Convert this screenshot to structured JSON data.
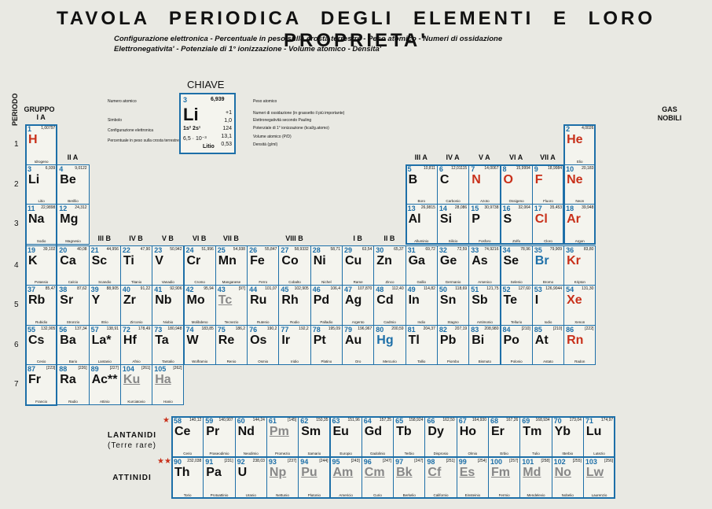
{
  "title": "TAVOLA PERIODICA DEGLI ELEMENTI E LORO PROPRIETA'",
  "subtitle_line1": "Configurazione elettronica - Percentuale in peso sulla crosta terrestre - Peso atomico - Numeri di ossidazione",
  "subtitle_line2": "Elettronegativita' - Potenziale di 1° ionizzazione - Volume atomico - Densita'",
  "periodo_label": "PERIODO",
  "gruppo_label": "GRUPPO",
  "gas_nobili_label": "GAS NOBILI",
  "periods": [
    "1",
    "2",
    "3",
    "4",
    "5",
    "6",
    "7"
  ],
  "group_labels": {
    "IA": "I A",
    "IIA": "II A",
    "IIIA": "III A",
    "IVA": "IV A",
    "VA": "V A",
    "VIA": "VI A",
    "VIIA": "VII A",
    "IIIB": "III B",
    "IVB": "IV B",
    "VB": "V B",
    "VIB": "VI B",
    "VIIB": "VII B",
    "VIIIB": "VIII B",
    "IB": "I B",
    "IIB": "II B"
  },
  "key": {
    "title": "CHIAVE",
    "number": "3",
    "weight": "6,939",
    "symbol": "Li",
    "config": "1s² 2s¹",
    "percent": "6,5 · 10⁻³",
    "name": "Litio",
    "values": [
      "+1",
      "1,0",
      "124",
      "13,1",
      "0,53"
    ],
    "labels_left": [
      "Numero atomico",
      "Simbolo",
      "Configurazione elettronica",
      "Percentuale in peso sulla crosta terrestre"
    ],
    "labels_right": [
      "Peso atomico",
      "Numeri di ossidazione (in grassetto il più importante)",
      "Elettronegatività secondo Pauling",
      "Potenziale di 1° ionizzazione (kcal/g.atomo)",
      "Volume atomico (P/D)",
      "Densità (g/ml)"
    ]
  },
  "lantanidi_label": "LANTANIDI",
  "terre_rare_label": "(Terre rare)",
  "attinidi_label": "ATTINIDI",
  "elements": [
    {
      "z": "1",
      "s": "H",
      "w": "1,00797",
      "n": "Idrogeno",
      "c": "red"
    },
    {
      "z": "2",
      "s": "He",
      "w": "4,0026",
      "n": "Elio",
      "c": "red"
    },
    {
      "z": "3",
      "s": "Li",
      "w": "6,939",
      "n": "Litio"
    },
    {
      "z": "4",
      "s": "Be",
      "w": "9,0122",
      "n": "Berillio"
    },
    {
      "z": "5",
      "s": "B",
      "w": "10,811",
      "n": "Boro"
    },
    {
      "z": "6",
      "s": "C",
      "w": "12,01115",
      "n": "Carbonio"
    },
    {
      "z": "7",
      "s": "N",
      "w": "14,0067",
      "n": "Azoto",
      "c": "red"
    },
    {
      "z": "8",
      "s": "O",
      "w": "15,9994",
      "n": "Ossigeno",
      "c": "red"
    },
    {
      "z": "9",
      "s": "F",
      "w": "18,9984",
      "n": "Fluoro",
      "c": "red"
    },
    {
      "z": "10",
      "s": "Ne",
      "w": "20,183",
      "n": "Neon",
      "c": "red"
    },
    {
      "z": "11",
      "s": "Na",
      "w": "22,9898",
      "n": "Sodio"
    },
    {
      "z": "12",
      "s": "Mg",
      "w": "24,312",
      "n": "Magnesio"
    },
    {
      "z": "13",
      "s": "Al",
      "w": "26,9815",
      "n": "Alluminio"
    },
    {
      "z": "14",
      "s": "Si",
      "w": "28,086",
      "n": "Silicio"
    },
    {
      "z": "15",
      "s": "P",
      "w": "30,9738",
      "n": "Fosforo"
    },
    {
      "z": "16",
      "s": "S",
      "w": "32,064",
      "n": "Zolfo"
    },
    {
      "z": "17",
      "s": "Cl",
      "w": "35,453",
      "n": "Cloro",
      "c": "red"
    },
    {
      "z": "18",
      "s": "Ar",
      "w": "39,948",
      "n": "Argon",
      "c": "red"
    },
    {
      "z": "19",
      "s": "K",
      "w": "39,102",
      "n": "Potassio"
    },
    {
      "z": "20",
      "s": "Ca",
      "w": "40,08",
      "n": "Calcio"
    },
    {
      "z": "21",
      "s": "Sc",
      "w": "44,956",
      "n": "Scandio"
    },
    {
      "z": "22",
      "s": "Ti",
      "w": "47,90",
      "n": "Titanio"
    },
    {
      "z": "23",
      "s": "V",
      "w": "50,942",
      "n": "Vanadio"
    },
    {
      "z": "24",
      "s": "Cr",
      "w": "51,996",
      "n": "Cromo"
    },
    {
      "z": "25",
      "s": "Mn",
      "w": "54,938",
      "n": "Manganese"
    },
    {
      "z": "26",
      "s": "Fe",
      "w": "55,847",
      "n": "Ferro"
    },
    {
      "z": "27",
      "s": "Co",
      "w": "58,9332",
      "n": "Cobalto"
    },
    {
      "z": "28",
      "s": "Ni",
      "w": "58,71",
      "n": "Nichel"
    },
    {
      "z": "29",
      "s": "Cu",
      "w": "63,54",
      "n": "Rame"
    },
    {
      "z": "30",
      "s": "Zn",
      "w": "65,37",
      "n": "Zinco"
    },
    {
      "z": "31",
      "s": "Ga",
      "w": "69,72",
      "n": "Gallio"
    },
    {
      "z": "32",
      "s": "Ge",
      "w": "72,59",
      "n": "Germanio"
    },
    {
      "z": "33",
      "s": "As",
      "w": "74,9216",
      "n": "Arsenico"
    },
    {
      "z": "34",
      "s": "Se",
      "w": "78,96",
      "n": "Selenio"
    },
    {
      "z": "35",
      "s": "Br",
      "w": "79,909",
      "n": "Bromo",
      "c": "blue"
    },
    {
      "z": "36",
      "s": "Kr",
      "w": "83,80",
      "n": "Kripton",
      "c": "red"
    },
    {
      "z": "37",
      "s": "Rb",
      "w": "85,47",
      "n": "Rubidio"
    },
    {
      "z": "38",
      "s": "Sr",
      "w": "87,62",
      "n": "Stronzio"
    },
    {
      "z": "39",
      "s": "Y",
      "w": "88,905",
      "n": "Ittrio"
    },
    {
      "z": "40",
      "s": "Zr",
      "w": "91,22",
      "n": "Zirconio"
    },
    {
      "z": "41",
      "s": "Nb",
      "w": "92,906",
      "n": "Niobio"
    },
    {
      "z": "42",
      "s": "Mo",
      "w": "95,94",
      "n": "Molibdeno"
    },
    {
      "z": "43",
      "s": "Tc",
      "w": "[97]",
      "n": "Tecnezio",
      "c": "ghost"
    },
    {
      "z": "44",
      "s": "Ru",
      "w": "101,07",
      "n": "Rutenio"
    },
    {
      "z": "45",
      "s": "Rh",
      "w": "102,905",
      "n": "Rodio"
    },
    {
      "z": "46",
      "s": "Pd",
      "w": "106,4",
      "n": "Palladio"
    },
    {
      "z": "47",
      "s": "Ag",
      "w": "107,870",
      "n": "Argento"
    },
    {
      "z": "48",
      "s": "Cd",
      "w": "112,40",
      "n": "Cadmio"
    },
    {
      "z": "49",
      "s": "In",
      "w": "114,82",
      "n": "Indio"
    },
    {
      "z": "50",
      "s": "Sn",
      "w": "118,69",
      "n": "Stagno"
    },
    {
      "z": "51",
      "s": "Sb",
      "w": "121,75",
      "n": "Antimonio"
    },
    {
      "z": "52",
      "s": "Te",
      "w": "127,60",
      "n": "Tellurio"
    },
    {
      "z": "53",
      "s": "I",
      "w": "126,9044",
      "n": "Iodio"
    },
    {
      "z": "54",
      "s": "Xe",
      "w": "131,30",
      "n": "Xenon",
      "c": "red"
    },
    {
      "z": "55",
      "s": "Cs",
      "w": "132,905",
      "n": "Cesio"
    },
    {
      "z": "56",
      "s": "Ba",
      "w": "137,34",
      "n": "Bario"
    },
    {
      "z": "57",
      "s": "La*",
      "w": "138,91",
      "n": "Lantanio"
    },
    {
      "z": "72",
      "s": "Hf",
      "w": "178,49",
      "n": "Afnio"
    },
    {
      "z": "73",
      "s": "Ta",
      "w": "180,948",
      "n": "Tantalio"
    },
    {
      "z": "74",
      "s": "W",
      "w": "183,85",
      "n": "Wolframio"
    },
    {
      "z": "75",
      "s": "Re",
      "w": "186,2",
      "n": "Renio"
    },
    {
      "z": "76",
      "s": "Os",
      "w": "190,2",
      "n": "Osmio"
    },
    {
      "z": "77",
      "s": "Ir",
      "w": "192,2",
      "n": "Iridio"
    },
    {
      "z": "78",
      "s": "Pt",
      "w": "195,09",
      "n": "Platino"
    },
    {
      "z": "79",
      "s": "Au",
      "w": "196,967",
      "n": "Oro"
    },
    {
      "z": "80",
      "s": "Hg",
      "w": "200,59",
      "n": "Mercurio",
      "c": "blue"
    },
    {
      "z": "81",
      "s": "Tl",
      "w": "204,37",
      "n": "Tallio"
    },
    {
      "z": "82",
      "s": "Pb",
      "w": "207,19",
      "n": "Piombo"
    },
    {
      "z": "83",
      "s": "Bi",
      "w": "208,980",
      "n": "Bismuto"
    },
    {
      "z": "84",
      "s": "Po",
      "w": "[210]",
      "n": "Polonio"
    },
    {
      "z": "85",
      "s": "At",
      "w": "[210]",
      "n": "Astato"
    },
    {
      "z": "86",
      "s": "Rn",
      "w": "[222]",
      "n": "Radon",
      "c": "red"
    },
    {
      "z": "87",
      "s": "Fr",
      "w": "[223]",
      "n": "Francio"
    },
    {
      "z": "88",
      "s": "Ra",
      "w": "[226]",
      "n": "Radio"
    },
    {
      "z": "89",
      "s": "Ac**",
      "w": "[227]",
      "n": "Attinio"
    },
    {
      "z": "104",
      "s": "Ku",
      "w": "[261]",
      "n": "Kurciatovio",
      "c": "ghost"
    },
    {
      "z": "105",
      "s": "Ha",
      "w": "[262]",
      "n": "Hanio",
      "c": "ghost"
    }
  ],
  "lanthanides": [
    {
      "z": "58",
      "s": "Ce",
      "w": "140,12",
      "n": "Cerio"
    },
    {
      "z": "59",
      "s": "Pr",
      "w": "140,907",
      "n": "Praseodimio"
    },
    {
      "z": "60",
      "s": "Nd",
      "w": "144,24",
      "n": "Neodimio"
    },
    {
      "z": "61",
      "s": "Pm",
      "w": "[145]",
      "n": "Promezio",
      "c": "ghost"
    },
    {
      "z": "62",
      "s": "Sm",
      "w": "150,35",
      "n": "Samario"
    },
    {
      "z": "63",
      "s": "Eu",
      "w": "151,96",
      "n": "Europio"
    },
    {
      "z": "64",
      "s": "Gd",
      "w": "157,25",
      "n": "Gadolinio"
    },
    {
      "z": "65",
      "s": "Tb",
      "w": "158,924",
      "n": "Terbio"
    },
    {
      "z": "66",
      "s": "Dy",
      "w": "162,50",
      "n": "Disprosio"
    },
    {
      "z": "67",
      "s": "Ho",
      "w": "164,930",
      "n": "Olmio"
    },
    {
      "z": "68",
      "s": "Er",
      "w": "167,26",
      "n": "Erbio"
    },
    {
      "z": "69",
      "s": "Tm",
      "w": "168,934",
      "n": "Tulio"
    },
    {
      "z": "70",
      "s": "Yb",
      "w": "173,04",
      "n": "Itterbio"
    },
    {
      "z": "71",
      "s": "Lu",
      "w": "174,97",
      "n": "Lutezio"
    }
  ],
  "actinides": [
    {
      "z": "90",
      "s": "Th",
      "w": "232,038",
      "n": "Torio"
    },
    {
      "z": "91",
      "s": "Pa",
      "w": "[231]",
      "n": "Protoattinio"
    },
    {
      "z": "92",
      "s": "U",
      "w": "238,03",
      "n": "Uranio"
    },
    {
      "z": "93",
      "s": "Np",
      "w": "[237]",
      "n": "Nettunio",
      "c": "ghost"
    },
    {
      "z": "94",
      "s": "Pu",
      "w": "[244]",
      "n": "Plutonio",
      "c": "ghost"
    },
    {
      "z": "95",
      "s": "Am",
      "w": "[243]",
      "n": "Americio",
      "c": "ghost"
    },
    {
      "z": "96",
      "s": "Cm",
      "w": "[247]",
      "n": "Curio",
      "c": "ghost"
    },
    {
      "z": "97",
      "s": "Bk",
      "w": "[247]",
      "n": "Berkelio",
      "c": "ghost"
    },
    {
      "z": "98",
      "s": "Cf",
      "w": "[251]",
      "n": "Californio",
      "c": "ghost"
    },
    {
      "z": "99",
      "s": "Es",
      "w": "[254]",
      "n": "Einsteinio",
      "c": "ghost"
    },
    {
      "z": "100",
      "s": "Fm",
      "w": "[257]",
      "n": "Fermio",
      "c": "ghost"
    },
    {
      "z": "101",
      "s": "Md",
      "w": "[258]",
      "n": "Mendelevio",
      "c": "ghost"
    },
    {
      "z": "102",
      "s": "No",
      "w": "[255]",
      "n": "Nobelio",
      "c": "ghost"
    },
    {
      "z": "103",
      "s": "Lw",
      "w": "[256]",
      "n": "Laurenzio",
      "c": "ghost"
    }
  ]
}
